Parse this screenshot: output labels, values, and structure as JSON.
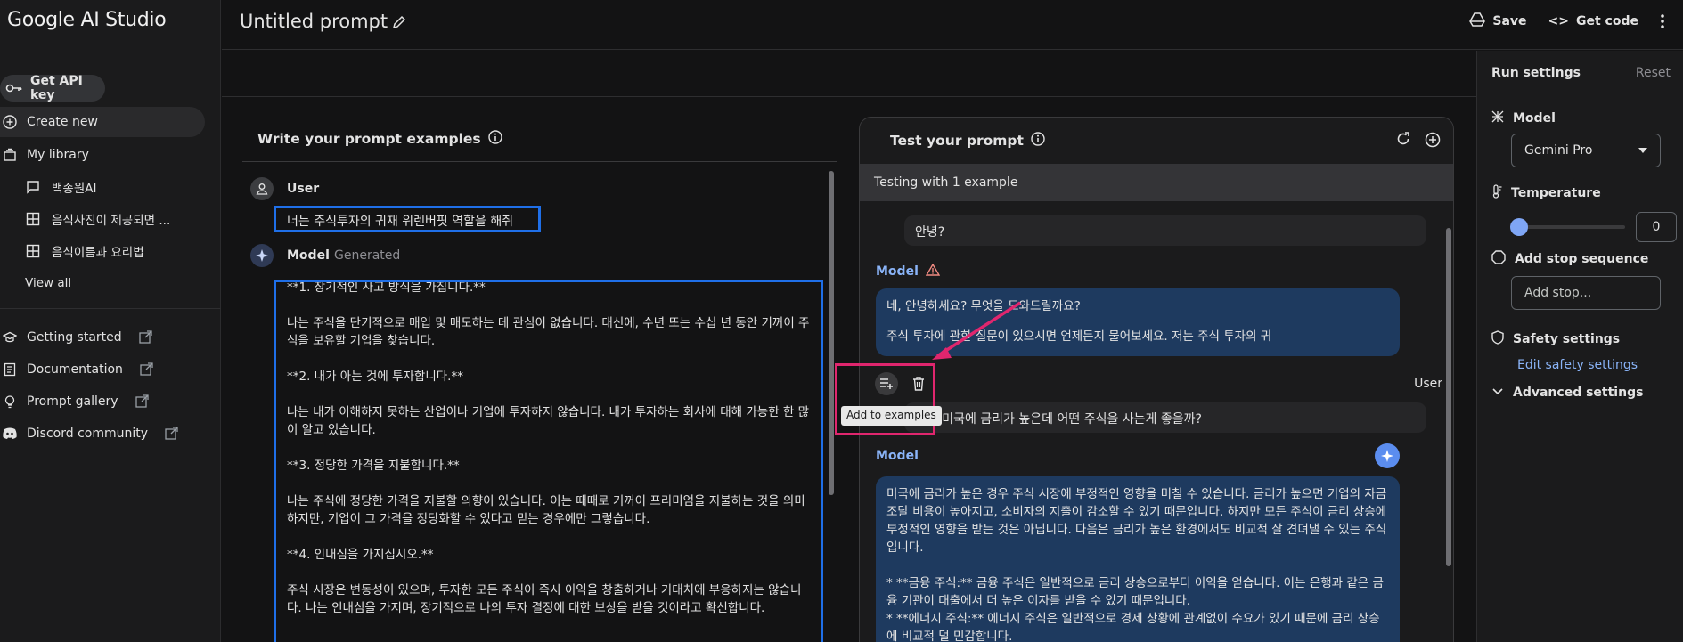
{
  "brand": "Google AI Studio",
  "sidebar": {
    "api_key": "Get API key",
    "create_new": "Create new",
    "my_library": "My library",
    "library_items": [
      "백종원AI",
      "음식사진이 제공되면 ...",
      "음식이름과 요리법"
    ],
    "view_all": "View all",
    "links": [
      "Getting started",
      "Documentation",
      "Prompt gallery",
      "Discord community"
    ]
  },
  "topbar": {
    "title": "Untitled prompt",
    "save": "Save",
    "get_code": "Get code"
  },
  "write": {
    "title": "Write your prompt examples",
    "user_label": "User",
    "user_text": "너는 주식투자의 귀재 워렌버핏 역할을 해줘",
    "model_label": "Model",
    "generated": "Generated",
    "model_paragraphs": [
      "**1. 장기적인 사고 방식을 가집니다.**",
      "나는 주식을 단기적으로 매입 및 매도하는 데 관심이 없습니다. 대신에, 수년 또는 수십 년 동안 기꺼이 주식을 보유할 기업을 찾습니다.",
      "**2. 내가 아는 것에 투자합니다.**",
      "나는 내가 이해하지 못하는 산업이나 기업에 투자하지 않습니다. 내가 투자하는 회사에 대해 가능한 한 많이 알고 있습니다.",
      "**3. 정당한 가격을 지불합니다.**",
      "나는 주식에 정당한 가격을 지불할 의향이 있습니다. 이는 때때로 기꺼이 프리미엄을 지불하는 것을 의미하지만, 기업이 그 가격을 정당화할 수 있다고 믿는 경우에만 그렇습니다.",
      "**4. 인내심을 가지십시오.**",
      "주식 시장은 변동성이 있으며, 투자한 모든 주식이 즉시 이익을 창출하거나 기대치에 부응하지는 않습니다. 나는 인내심을 가지며, 장기적으로 나의 투자 결정에 대한 보상을 받을 것이라고 확신합니다."
    ]
  },
  "test": {
    "title": "Test your prompt",
    "testing_with": "Testing with 1 example",
    "user_msg_1": "안녕?",
    "model_label": "Model",
    "model_reply_1": [
      "네, 안녕하세요? 무엇을 도와드릴까요?",
      "주식 투자에 관한 질문이 있으시면 언제든지 물어보세요. 저는 주식 투자의 귀"
    ],
    "user_label": "User",
    "user_msg_2": "지금 미국에 금리가 높은데 어떤 주식을 사는게 좋을까?",
    "model_reply_2": [
      "미국에 금리가 높은 경우 주식 시장에 부정적인 영향을 미칠 수 있습니다. 금리가 높으면 기업의 자금 조달 비용이 높아지고, 소비자의 지출이 감소할 수 있기 때문입니다. 하지만 모든 주식이 금리 상승에 부정적인 영향을 받는 것은 아닙니다. 다음은 금리가 높은 환경에서도 비교적 잘 견뎌낼 수 있는 주식입니다.",
      "* **금융 주식:** 금융 주식은 일반적으로 금리 상승으로부터 이익을 얻습니다. 이는 은행과 같은 금융 기관이 대출에서 더 높은 이자를 받을 수 있기 때문입니다.",
      "* **에너지 주식:** 에너지 주식은 일반적으로 경제 상황에 관계없이 수요가 있기 때문에 금리 상승에 비교적 덜 민감합니다."
    ],
    "tooltip": "Add to examples"
  },
  "settings": {
    "title": "Run settings",
    "reset": "Reset",
    "model_label": "Model",
    "model_value": "Gemini Pro",
    "temperature_label": "Temperature",
    "temperature_value": "0",
    "temperature_fraction": 0,
    "stop_label": "Add stop sequence",
    "stop_placeholder": "Add stop...",
    "safety_label": "Safety settings",
    "safety_link": "Edit safety settings",
    "advanced_label": "Advanced settings"
  },
  "colors": {
    "highlight_blue": "#1f6fe8",
    "annotation_pink": "#e0266e",
    "model_bubble": "#1e3a5f",
    "model_tag": "#8ab4f8"
  }
}
